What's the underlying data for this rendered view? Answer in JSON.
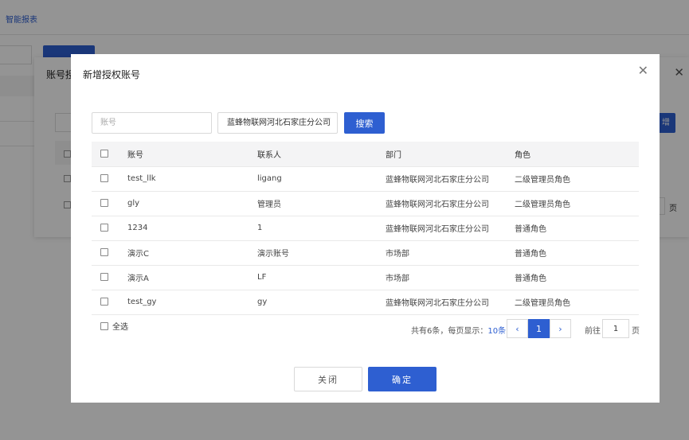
{
  "background": {
    "page_title": "智能报表",
    "dialog_title": "账号授",
    "button_fragment": "增",
    "pager_unit": "页"
  },
  "dialog": {
    "title": "新增授权账号",
    "close_symbol": "✕",
    "account_placeholder": "账号",
    "dept_select_value": "蓝蜂物联网河北石家庄分公司",
    "search_label": "搜索"
  },
  "table": {
    "headers": [
      "账号",
      "联系人",
      "部门",
      "角色"
    ],
    "rows": [
      [
        "test_llk",
        "ligang",
        "蓝蜂物联网河北石家庄分公司",
        "二级管理员角色"
      ],
      [
        "gly",
        "管理员",
        "蓝蜂物联网河北石家庄分公司",
        "二级管理员角色"
      ],
      [
        "1234",
        "1",
        "蓝蜂物联网河北石家庄分公司",
        "普通角色"
      ],
      [
        "演示C",
        "演示账号",
        "市场部",
        "普通角色"
      ],
      [
        "演示A",
        "LF",
        "市场部",
        "普通角色"
      ],
      [
        "test_gy",
        "gy",
        "蓝蜂物联网河北石家庄分公司",
        "二级管理员角色"
      ]
    ]
  },
  "footer": {
    "select_all_label": "全选",
    "total_prefix": "共有6条，每页显示：",
    "page_size": "10条",
    "prev_symbol": "‹",
    "current_page": "1",
    "next_symbol": "›",
    "goto_label": "前往",
    "goto_value": "1",
    "goto_unit": "页"
  },
  "actions": {
    "close_label": "关闭",
    "confirm_label": "确定"
  },
  "colors": {
    "primary": "#2e5fd1",
    "overlay": "rgba(0,0,0,0.42)"
  }
}
